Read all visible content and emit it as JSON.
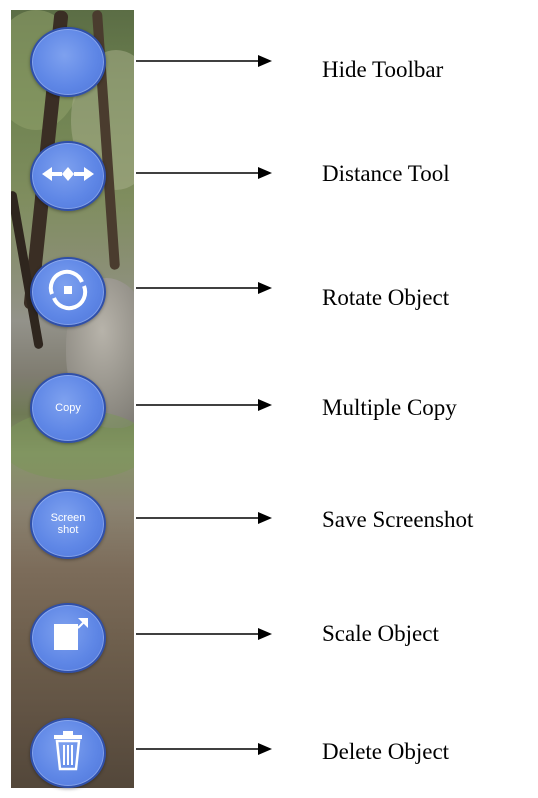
{
  "toolbar": {
    "buttons": [
      {
        "id": "hide-toolbar",
        "icon": "blank-circle",
        "text": ""
      },
      {
        "id": "distance-tool",
        "icon": "distance-arrows-icon",
        "text": ""
      },
      {
        "id": "rotate-object",
        "icon": "rotate-circle-icon",
        "text": ""
      },
      {
        "id": "multiple-copy",
        "icon": "text",
        "text": "Copy"
      },
      {
        "id": "save-screenshot",
        "icon": "text",
        "text": "Screen shot"
      },
      {
        "id": "scale-object",
        "icon": "scale-square-icon",
        "text": ""
      },
      {
        "id": "delete-object",
        "icon": "trash-icon",
        "text": ""
      }
    ],
    "button_color": "#5f87e6",
    "button_border_color": "#2f4fa8"
  },
  "labels": {
    "hide_toolbar": "Hide Toolbar",
    "distance_tool": "Distance Tool",
    "rotate_object": "Rotate Object",
    "multiple_copy": "Multiple Copy",
    "save_screenshot": "Save Screenshot",
    "scale_object": "Scale Object",
    "delete_object": "Delete Object"
  },
  "buttons_text": {
    "copy": "Copy",
    "screenshot": "Screen shot"
  }
}
